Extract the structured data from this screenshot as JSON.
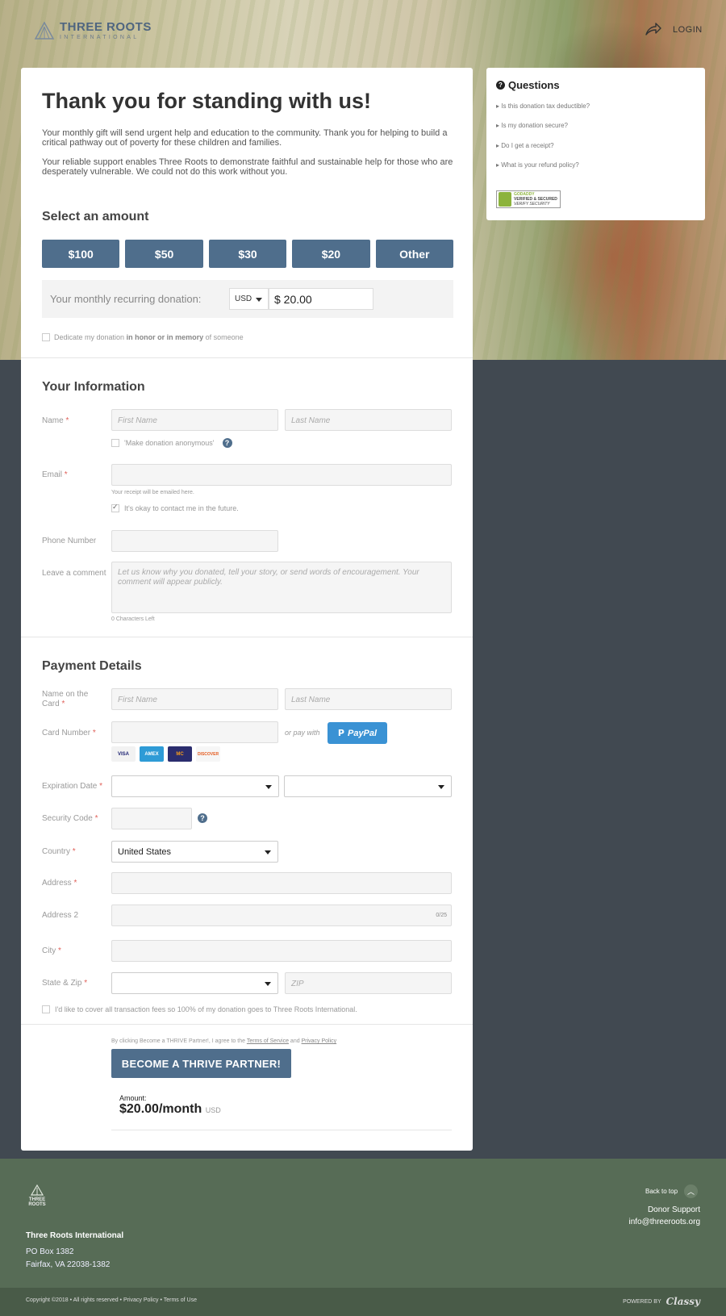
{
  "header": {
    "logo_name_bold": "THREE ROOTS",
    "logo_sub": "INTERNATIONAL",
    "login_label": "LOGIN"
  },
  "main": {
    "title": "Thank you for standing with us!",
    "intro_1": "Your monthly gift will send urgent help and education to the community. Thank you for helping to build a critical pathway out of poverty for these children and families.",
    "intro_2": "Your reliable support enables Three Roots to demonstrate faithful and sustainable help for those who are desperately vulnerable. We could not do this work without you.",
    "amount_heading": "Select an amount",
    "amounts": [
      "$100",
      "$50",
      "$30",
      "$20",
      "Other"
    ],
    "recurring_label": "Your monthly recurring donation:",
    "currency": "USD",
    "amount_value": "$ 20.00",
    "dedicate_pre": "Dedicate my donation",
    "dedicate_bold": "in honor or in memory",
    "dedicate_post": "of someone"
  },
  "info": {
    "heading": "Your Information",
    "name_label": "Name",
    "first_placeholder": "First Name",
    "last_placeholder": "Last Name",
    "anonymous_label": "'Make donation anonymous'",
    "email_label": "Email",
    "email_hint": "Your receipt will be emailed here.",
    "contact_label": "It's okay to contact me in the future.",
    "phone_label": "Phone Number",
    "comment_label": "Leave a comment",
    "comment_placeholder": "Let us know why you donated, tell your story, or send words of encouragement. Your comment will appear publicly.",
    "chars_left": "0 Characters Left"
  },
  "payment": {
    "heading": "Payment Details",
    "card_name_label_1": "Name on the",
    "card_name_label_2": "Card",
    "first_placeholder": "First Name",
    "last_placeholder": "Last Name",
    "card_number_label": "Card Number",
    "or_pay_with": "or pay with",
    "paypal_label": "PayPal",
    "card_logos": [
      "VISA",
      "AMEX",
      "MC",
      "DISCOVER"
    ],
    "expiration_label": "Expiration Date",
    "security_label": "Security Code",
    "country_label": "Country",
    "country_value": "United States",
    "address_label": "Address",
    "address2_label": "Address 2",
    "address2_counter": "0/25",
    "city_label": "City",
    "statezip_label": "State & Zip",
    "zip_placeholder": "ZIP",
    "fees_label": "I'd like to cover all transaction fees so 100% of my donation goes to Three Roots International."
  },
  "submit": {
    "terms_pre": "By clicking Become a THRIVE Partner!, I agree to the",
    "terms_link": "Terms of Service",
    "terms_and": "and",
    "privacy_link": "Privacy Policy",
    "cta_label": "BECOME A THRIVE PARTNER!",
    "amount_caption": "Amount:",
    "amount_total": "$20.00/month",
    "amount_currency": "USD"
  },
  "questions": {
    "title": "Questions",
    "items": [
      "Is this donation tax deductible?",
      "Is my donation secure?",
      "Do I get a receipt?",
      "What is your refund policy?"
    ],
    "seal_1": "GODADDY",
    "seal_2": "VERIFIED & SECURED",
    "seal_3": "VERIFY SECURITY"
  },
  "footer": {
    "logo_text_1": "THREE",
    "logo_text_2": "ROOTS",
    "org": "Three Roots International",
    "address_1": "PO Box 1382",
    "address_2": "Fairfax, VA 22038-1382",
    "back_to_top": "Back to top",
    "support": "Donor Support",
    "support_email": "info@threeroots.org",
    "copyright": "Copyright ©2018 • All rights reserved • Privacy Policy • Terms of Use",
    "powered_by": "POWERED BY",
    "powered_brand": "Classy"
  },
  "colors": {
    "accent": "#4f6e8c",
    "footer_bg": "#576c56",
    "page_bg": "#414951",
    "paypal": "#3a92d4",
    "required": "#e0615a"
  }
}
